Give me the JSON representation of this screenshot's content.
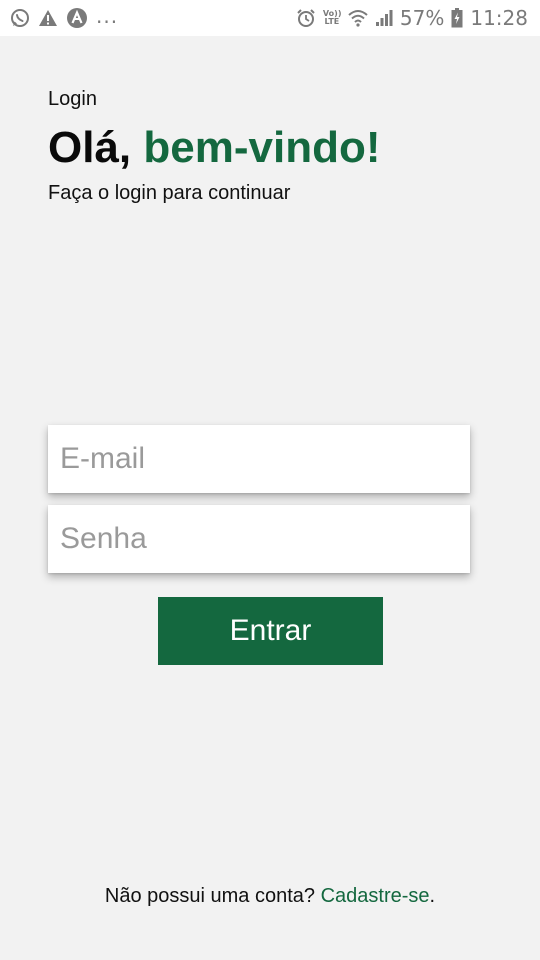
{
  "status_bar": {
    "left_icons": [
      "whatsapp-icon",
      "warning-icon",
      "app-notification-icon"
    ],
    "more_notifications": "...",
    "volte_line1": "Vo))",
    "volte_line2": "LTE",
    "battery_percent": "57%",
    "time": "11:28"
  },
  "header": {
    "eyebrow": "Login",
    "title_greeting": "Olá,",
    "title_accent": "bem-vindo!",
    "subtitle": "Faça o login para continuar"
  },
  "form": {
    "email_placeholder": "E-mail",
    "email_value": "",
    "password_placeholder": "Senha",
    "password_value": "",
    "submit_label": "Entrar"
  },
  "footer": {
    "prompt": "Não possui uma conta?",
    "signup_link": "Cadastre-se",
    "trailing": "."
  },
  "colors": {
    "accent": "#14683f",
    "background": "#f2f2f2",
    "status_icons": "#7a7a7a"
  }
}
